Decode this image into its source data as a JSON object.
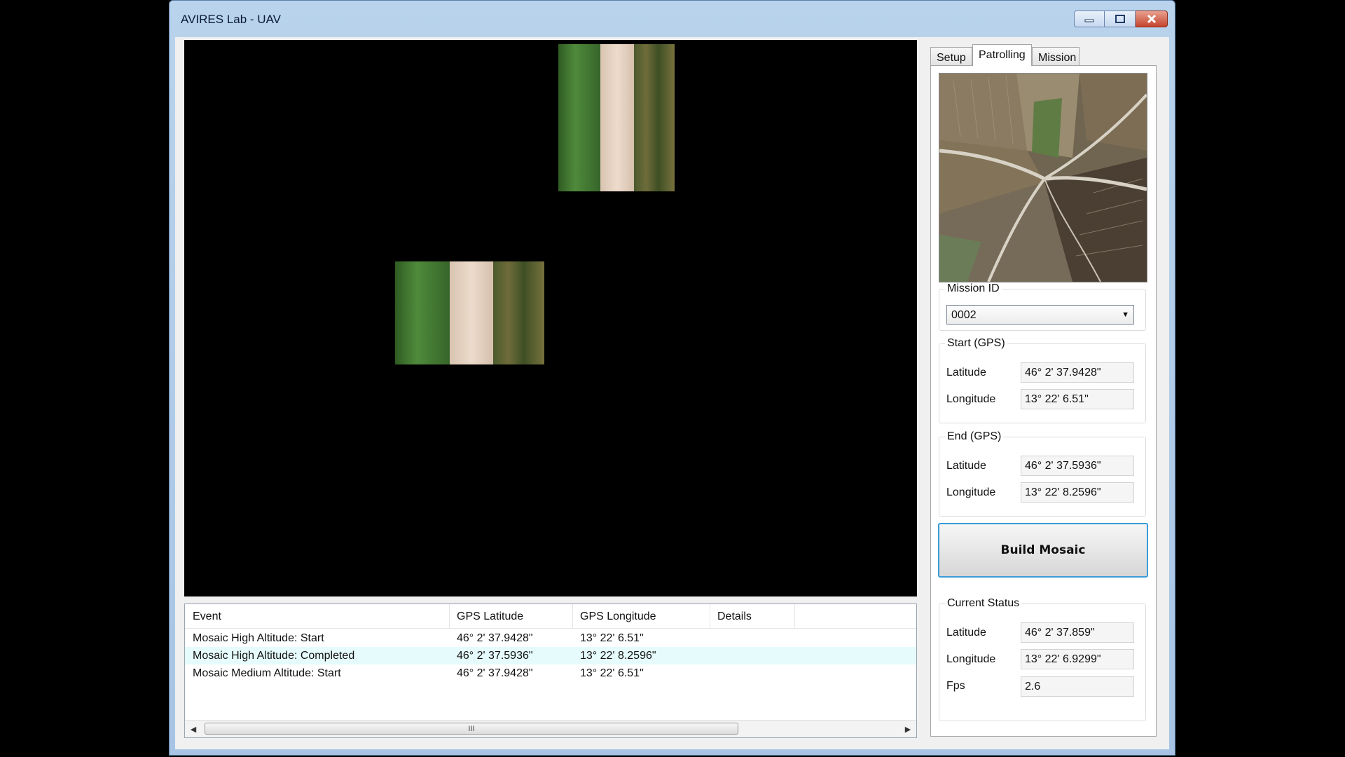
{
  "window": {
    "title": "AVIRES Lab - UAV"
  },
  "event_log": {
    "columns": [
      "Event",
      "GPS Latitude",
      "GPS Longitude",
      "Details"
    ],
    "rows": [
      {
        "event": "Mosaic High Altitude: Start",
        "lat": "46° 2' 37.9428\"",
        "lon": "13° 22' 6.51\"",
        "details": ""
      },
      {
        "event": "Mosaic High Altitude: Completed",
        "lat": "46° 2' 37.5936\"",
        "lon": "13° 22' 8.2596\"",
        "details": ""
      },
      {
        "event": "Mosaic Medium Altitude: Start",
        "lat": "46° 2' 37.9428\"",
        "lon": "13° 22' 6.51\"",
        "details": ""
      }
    ],
    "scroll_thumb_grip": "III"
  },
  "tabs": [
    "Setup",
    "Patrolling",
    "Mission"
  ],
  "active_tab": "Patrolling",
  "mission": {
    "label": "Mission ID",
    "selected": "0002"
  },
  "start_gps": {
    "label": "Start (GPS)",
    "lat_label": "Latitude",
    "lat": "46° 2' 37.9428\"",
    "lon_label": "Longitude",
    "lon": "13° 22' 6.51\""
  },
  "end_gps": {
    "label": "End (GPS)",
    "lat_label": "Latitude",
    "lat": "46° 2' 37.5936\"",
    "lon_label": "Longitude",
    "lon": "13° 22' 8.2596\""
  },
  "build_button": "Build Mosaic",
  "current_status": {
    "label": "Current Status",
    "lat_label": "Latitude",
    "lat": "46° 2' 37.859\"",
    "lon_label": "Longitude",
    "lon": "13° 22' 6.9299\"",
    "fps_label": "Fps",
    "fps": "2.6"
  },
  "icons": [
    "minimize-icon",
    "maximize-icon",
    "close-icon",
    "dropdown-arrow-icon",
    "scroll-left-icon",
    "scroll-right-icon"
  ]
}
